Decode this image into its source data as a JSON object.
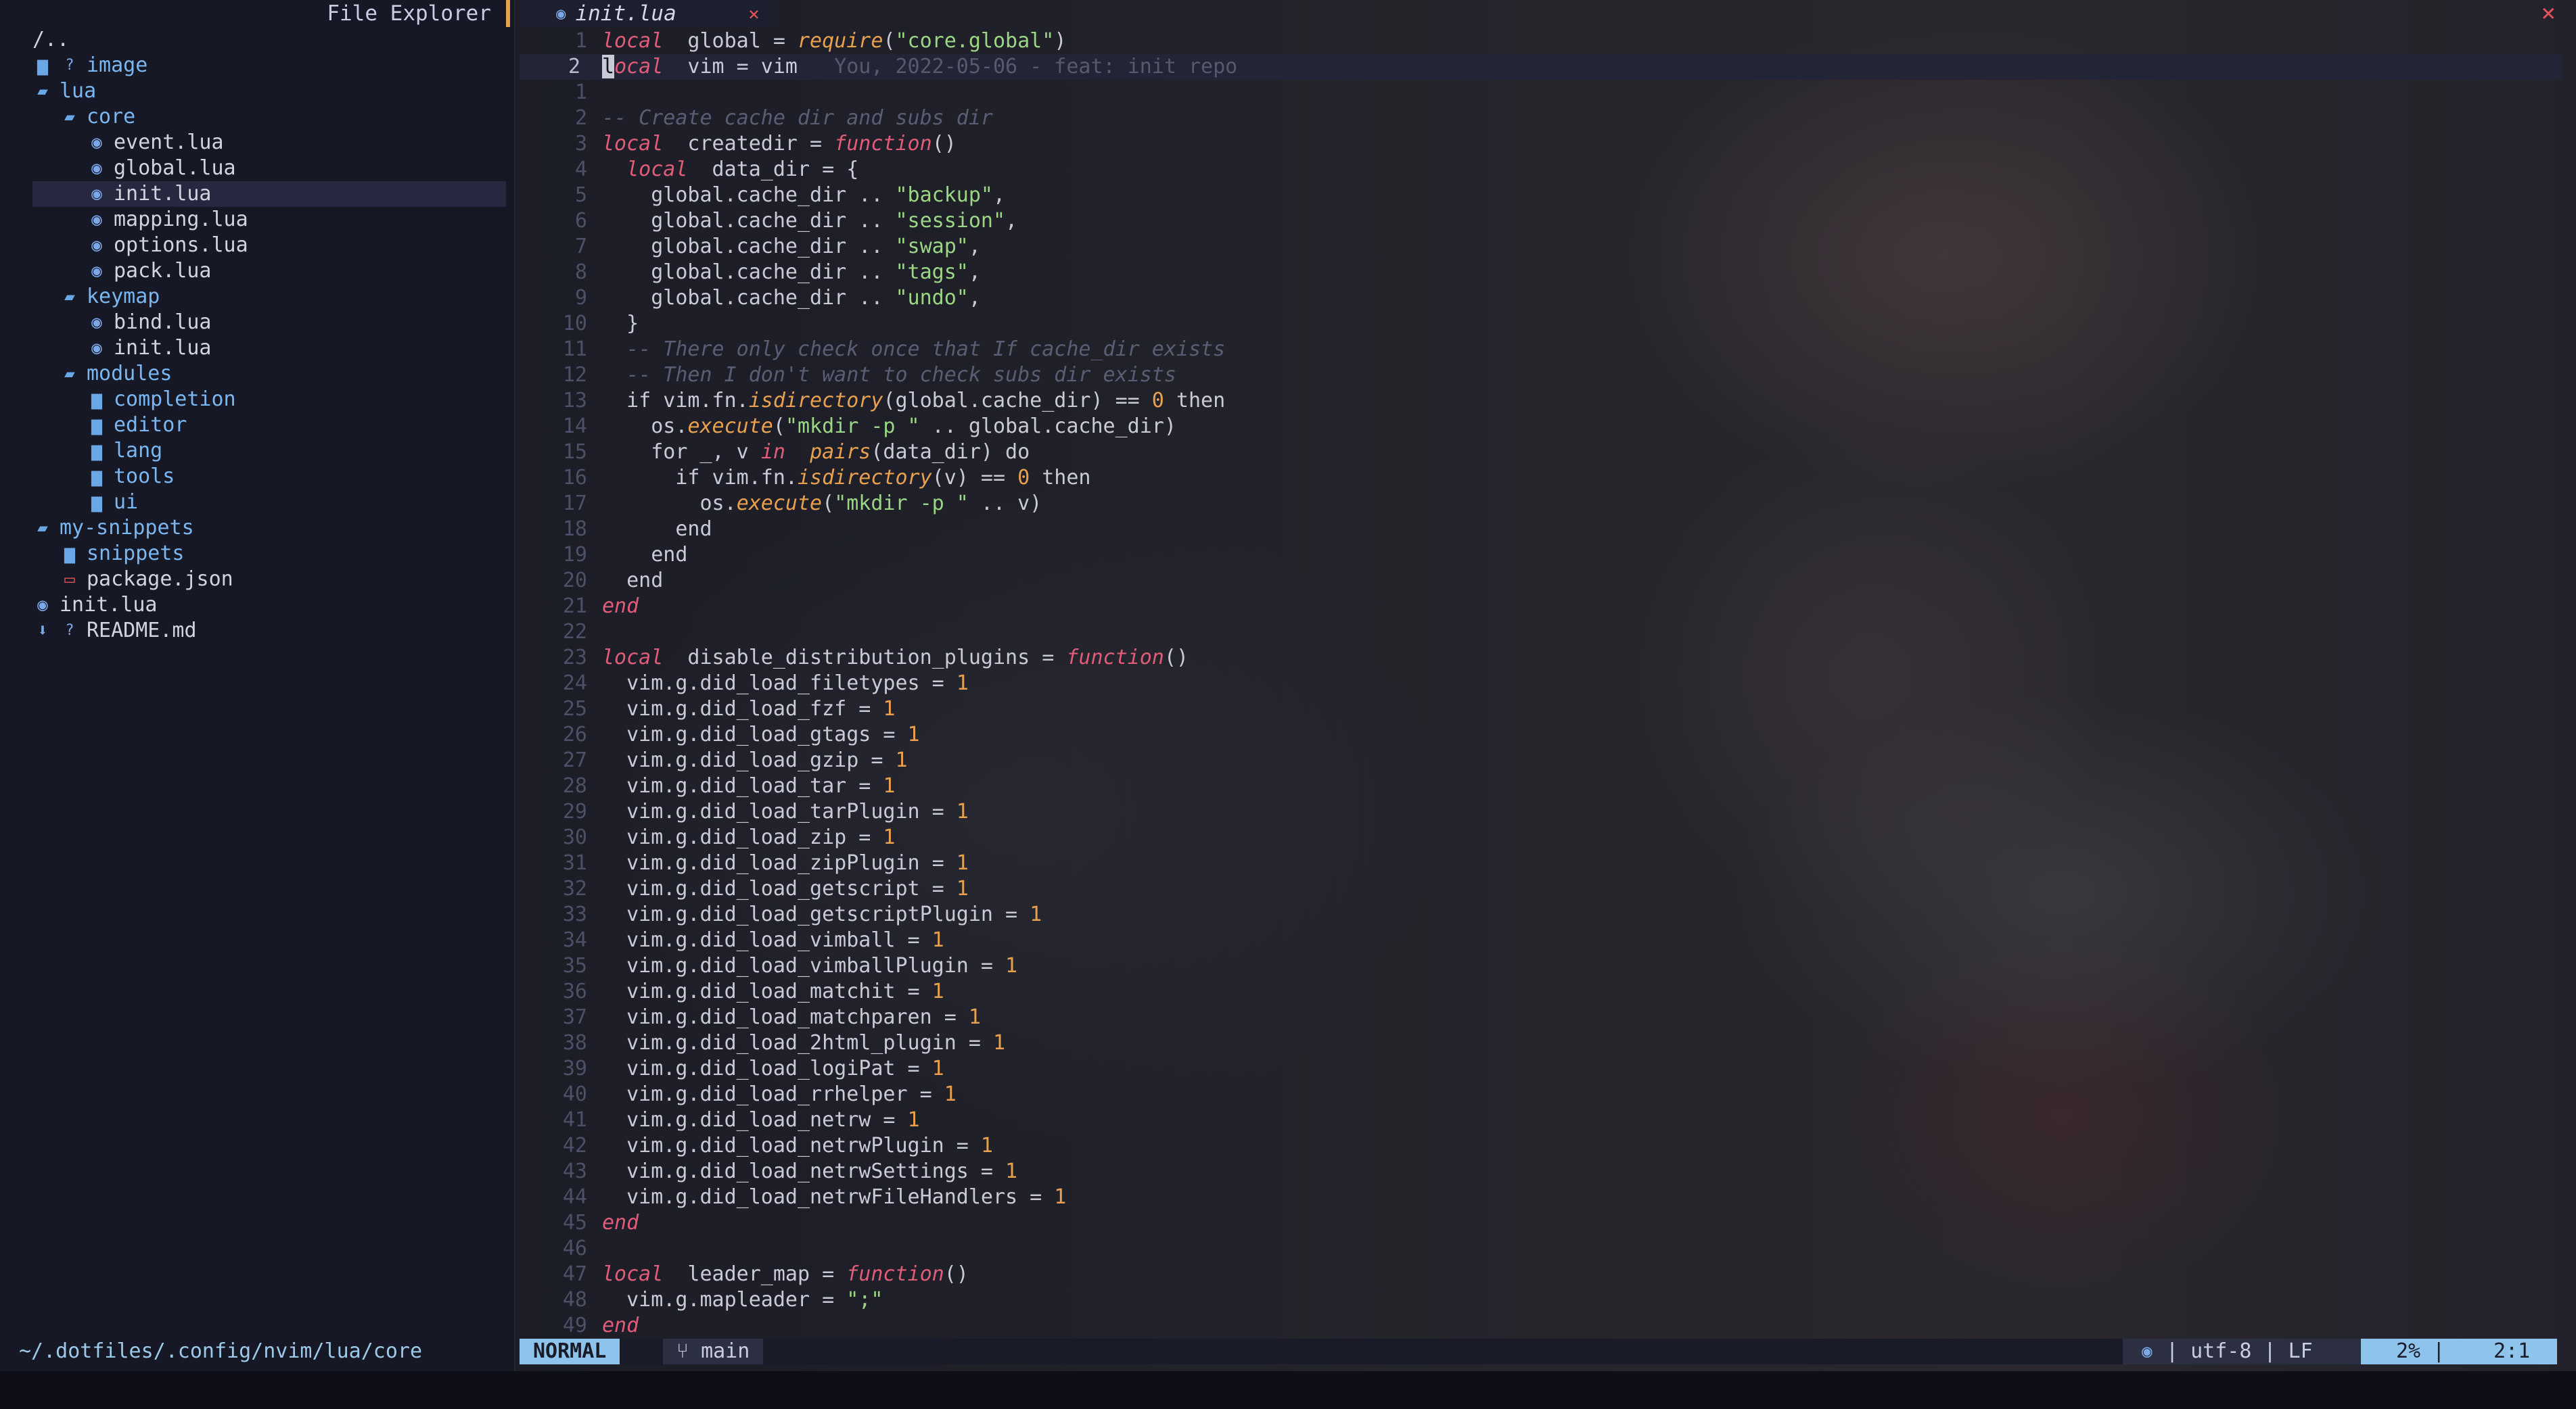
{
  "sidebar": {
    "title": "File Explorer",
    "cwd": "~/.dotfiles/.config/nvim/lua/core",
    "items": [
      {
        "depth": 0,
        "icon": "",
        "label": "/..",
        "kind": "parent"
      },
      {
        "depth": 0,
        "icon": "folder-icon",
        "label": "image",
        "kind": "dir",
        "badge": "?"
      },
      {
        "depth": 0,
        "icon": "folder-open-icon",
        "label": "lua",
        "kind": "dir"
      },
      {
        "depth": 1,
        "icon": "folder-open-icon",
        "label": "core",
        "kind": "dir"
      },
      {
        "depth": 2,
        "icon": "lua-icon",
        "label": "event.lua",
        "kind": "file"
      },
      {
        "depth": 2,
        "icon": "lua-icon",
        "label": "global.lua",
        "kind": "file"
      },
      {
        "depth": 2,
        "icon": "lua-icon",
        "label": "init.lua",
        "kind": "file",
        "selected": true
      },
      {
        "depth": 2,
        "icon": "lua-icon",
        "label": "mapping.lua",
        "kind": "file"
      },
      {
        "depth": 2,
        "icon": "lua-icon",
        "label": "options.lua",
        "kind": "file"
      },
      {
        "depth": 2,
        "icon": "lua-icon",
        "label": "pack.lua",
        "kind": "file"
      },
      {
        "depth": 1,
        "icon": "folder-open-icon",
        "label": "keymap",
        "kind": "dir"
      },
      {
        "depth": 2,
        "icon": "lua-icon",
        "label": "bind.lua",
        "kind": "file"
      },
      {
        "depth": 2,
        "icon": "lua-icon",
        "label": "init.lua",
        "kind": "file"
      },
      {
        "depth": 1,
        "icon": "folder-open-icon",
        "label": "modules",
        "kind": "dir"
      },
      {
        "depth": 2,
        "icon": "folder-icon",
        "label": "completion",
        "kind": "dir"
      },
      {
        "depth": 2,
        "icon": "folder-icon",
        "label": "editor",
        "kind": "dir"
      },
      {
        "depth": 2,
        "icon": "folder-icon",
        "label": "lang",
        "kind": "dir"
      },
      {
        "depth": 2,
        "icon": "folder-icon",
        "label": "tools",
        "kind": "dir"
      },
      {
        "depth": 2,
        "icon": "folder-icon",
        "label": "ui",
        "kind": "dir"
      },
      {
        "depth": 0,
        "icon": "folder-open-icon",
        "label": "my-snippets",
        "kind": "dir"
      },
      {
        "depth": 1,
        "icon": "folder-icon",
        "label": "snippets",
        "kind": "dir"
      },
      {
        "depth": 1,
        "icon": "json-icon",
        "label": "package.json",
        "kind": "json"
      },
      {
        "depth": 0,
        "icon": "lua-icon",
        "label": "init.lua",
        "kind": "file"
      },
      {
        "depth": 0,
        "icon": "markdown-icon",
        "label": "README.md",
        "kind": "md",
        "badge": "?"
      }
    ]
  },
  "tabline": {
    "active_tab": "init.lua",
    "tab_icon": "lua-icon",
    "tab_close": "×",
    "window_close": "×"
  },
  "editor": {
    "current_line": 2,
    "lines": [
      {
        "n": "1",
        "seg": [
          [
            "kw",
            "local"
          ],
          [
            "",
            "  global = "
          ],
          [
            "fn",
            "require"
          ],
          [
            "",
            "("
          ],
          [
            "str",
            "\"core.global\""
          ],
          [
            "",
            ")"
          ]
        ]
      },
      {
        "n": "2",
        "current": true,
        "seg": [
          [
            "cursor",
            "l"
          ],
          [
            "kw",
            "ocal"
          ],
          [
            "",
            "  vim = vim   "
          ],
          [
            "blame",
            "You, 2022-05-06 - feat: init repo"
          ]
        ]
      },
      {
        "n": "1",
        "seg": []
      },
      {
        "n": "2",
        "seg": [
          [
            "cm",
            "-- Create cache dir and subs dir"
          ]
        ]
      },
      {
        "n": "3",
        "seg": [
          [
            "kw",
            "local"
          ],
          [
            "",
            "  createdir = "
          ],
          [
            "kw",
            "function"
          ],
          [
            "",
            "()"
          ]
        ]
      },
      {
        "n": "4",
        "seg": [
          [
            "",
            "  "
          ],
          [
            "kw",
            "local"
          ],
          [
            "",
            "  data_dir = {"
          ]
        ]
      },
      {
        "n": "5",
        "seg": [
          [
            "",
            "    global.cache_dir .. "
          ],
          [
            "str",
            "\"backup\""
          ],
          [
            "",
            ","
          ]
        ]
      },
      {
        "n": "6",
        "seg": [
          [
            "",
            "    global.cache_dir .. "
          ],
          [
            "str",
            "\"session\""
          ],
          [
            "",
            ","
          ]
        ]
      },
      {
        "n": "7",
        "seg": [
          [
            "",
            "    global.cache_dir .. "
          ],
          [
            "str",
            "\"swap\""
          ],
          [
            "",
            ","
          ]
        ]
      },
      {
        "n": "8",
        "seg": [
          [
            "",
            "    global.cache_dir .. "
          ],
          [
            "str",
            "\"tags\""
          ],
          [
            "",
            ","
          ]
        ]
      },
      {
        "n": "9",
        "seg": [
          [
            "",
            "    global.cache_dir .. "
          ],
          [
            "str",
            "\"undo\""
          ],
          [
            "",
            ","
          ]
        ]
      },
      {
        "n": "10",
        "seg": [
          [
            "",
            "  }"
          ]
        ]
      },
      {
        "n": "11",
        "seg": [
          [
            "cm",
            "  -- There only check once that If cache_dir exists"
          ]
        ]
      },
      {
        "n": "12",
        "seg": [
          [
            "cm",
            "  -- Then I don't want to check subs dir exists"
          ]
        ]
      },
      {
        "n": "13",
        "seg": [
          [
            "",
            "  if vim.fn."
          ],
          [
            "fn",
            "isdirectory"
          ],
          [
            "",
            "(global.cache_dir) == "
          ],
          [
            "num",
            "0"
          ],
          [
            "",
            " then"
          ]
        ]
      },
      {
        "n": "14",
        "seg": [
          [
            "",
            "    os."
          ],
          [
            "fn",
            "execute"
          ],
          [
            "",
            "("
          ],
          [
            "str",
            "\"mkdir -p \""
          ],
          [
            "",
            " .. global.cache_dir)"
          ]
        ]
      },
      {
        "n": "15",
        "seg": [
          [
            "",
            "    for _, v "
          ],
          [
            "kw",
            "in"
          ],
          [
            "",
            "  "
          ],
          [
            "fn",
            "pairs"
          ],
          [
            "",
            "(data_dir) do"
          ]
        ]
      },
      {
        "n": "16",
        "seg": [
          [
            "",
            "      if vim.fn."
          ],
          [
            "fn",
            "isdirectory"
          ],
          [
            "",
            "(v) == "
          ],
          [
            "num",
            "0"
          ],
          [
            "",
            " then"
          ]
        ]
      },
      {
        "n": "17",
        "seg": [
          [
            "",
            "        os."
          ],
          [
            "fn",
            "execute"
          ],
          [
            "",
            "("
          ],
          [
            "str",
            "\"mkdir -p \""
          ],
          [
            "",
            " .. v)"
          ]
        ]
      },
      {
        "n": "18",
        "seg": [
          [
            "",
            "      end"
          ]
        ]
      },
      {
        "n": "19",
        "seg": [
          [
            "",
            "    end"
          ]
        ]
      },
      {
        "n": "20",
        "seg": [
          [
            "",
            "  end"
          ]
        ]
      },
      {
        "n": "21",
        "seg": [
          [
            "kw",
            "end"
          ]
        ]
      },
      {
        "n": "22",
        "seg": []
      },
      {
        "n": "23",
        "seg": [
          [
            "kw",
            "local"
          ],
          [
            "",
            "  disable_distribution_plugins = "
          ],
          [
            "kw",
            "function"
          ],
          [
            "",
            "()"
          ]
        ]
      },
      {
        "n": "24",
        "seg": [
          [
            "",
            "  vim.g.did_load_filetypes = "
          ],
          [
            "num",
            "1"
          ]
        ]
      },
      {
        "n": "25",
        "seg": [
          [
            "",
            "  vim.g.did_load_fzf = "
          ],
          [
            "num",
            "1"
          ]
        ]
      },
      {
        "n": "26",
        "seg": [
          [
            "",
            "  vim.g.did_load_gtags = "
          ],
          [
            "num",
            "1"
          ]
        ]
      },
      {
        "n": "27",
        "seg": [
          [
            "",
            "  vim.g.did_load_gzip = "
          ],
          [
            "num",
            "1"
          ]
        ]
      },
      {
        "n": "28",
        "seg": [
          [
            "",
            "  vim.g.did_load_tar = "
          ],
          [
            "num",
            "1"
          ]
        ]
      },
      {
        "n": "29",
        "seg": [
          [
            "",
            "  vim.g.did_load_tarPlugin = "
          ],
          [
            "num",
            "1"
          ]
        ]
      },
      {
        "n": "30",
        "seg": [
          [
            "",
            "  vim.g.did_load_zip = "
          ],
          [
            "num",
            "1"
          ]
        ]
      },
      {
        "n": "31",
        "seg": [
          [
            "",
            "  vim.g.did_load_zipPlugin = "
          ],
          [
            "num",
            "1"
          ]
        ]
      },
      {
        "n": "32",
        "seg": [
          [
            "",
            "  vim.g.did_load_getscript = "
          ],
          [
            "num",
            "1"
          ]
        ]
      },
      {
        "n": "33",
        "seg": [
          [
            "",
            "  vim.g.did_load_getscriptPlugin = "
          ],
          [
            "num",
            "1"
          ]
        ]
      },
      {
        "n": "34",
        "seg": [
          [
            "",
            "  vim.g.did_load_vimball = "
          ],
          [
            "num",
            "1"
          ]
        ]
      },
      {
        "n": "35",
        "seg": [
          [
            "",
            "  vim.g.did_load_vimballPlugin = "
          ],
          [
            "num",
            "1"
          ]
        ]
      },
      {
        "n": "36",
        "seg": [
          [
            "",
            "  vim.g.did_load_matchit = "
          ],
          [
            "num",
            "1"
          ]
        ]
      },
      {
        "n": "37",
        "seg": [
          [
            "",
            "  vim.g.did_load_matchparen = "
          ],
          [
            "num",
            "1"
          ]
        ]
      },
      {
        "n": "38",
        "seg": [
          [
            "",
            "  vim.g.did_load_2html_plugin = "
          ],
          [
            "num",
            "1"
          ]
        ]
      },
      {
        "n": "39",
        "seg": [
          [
            "",
            "  vim.g.did_load_logiPat = "
          ],
          [
            "num",
            "1"
          ]
        ]
      },
      {
        "n": "40",
        "seg": [
          [
            "",
            "  vim.g.did_load_rrhelper = "
          ],
          [
            "num",
            "1"
          ]
        ]
      },
      {
        "n": "41",
        "seg": [
          [
            "",
            "  vim.g.did_load_netrw = "
          ],
          [
            "num",
            "1"
          ]
        ]
      },
      {
        "n": "42",
        "seg": [
          [
            "",
            "  vim.g.did_load_netrwPlugin = "
          ],
          [
            "num",
            "1"
          ]
        ]
      },
      {
        "n": "43",
        "seg": [
          [
            "",
            "  vim.g.did_load_netrwSettings = "
          ],
          [
            "num",
            "1"
          ]
        ]
      },
      {
        "n": "44",
        "seg": [
          [
            "",
            "  vim.g.did_load_netrwFileHandlers = "
          ],
          [
            "num",
            "1"
          ]
        ]
      },
      {
        "n": "45",
        "seg": [
          [
            "kw",
            "end"
          ]
        ]
      },
      {
        "n": "46",
        "seg": []
      },
      {
        "n": "47",
        "seg": [
          [
            "kw",
            "local"
          ],
          [
            "",
            "  leader_map = "
          ],
          [
            "kw",
            "function"
          ],
          [
            "",
            "()"
          ]
        ]
      },
      {
        "n": "48",
        "seg": [
          [
            "",
            "  vim.g.mapleader = "
          ],
          [
            "str",
            "\";\""
          ]
        ]
      },
      {
        "n": "49",
        "seg": [
          [
            "kw",
            "end"
          ]
        ]
      }
    ]
  },
  "statusline": {
    "mode": "NORMAL",
    "branch_icon": "git-branch-icon",
    "branch": "main",
    "filetype_icon": "lua-icon",
    "encoding": "| utf-8 | LF",
    "percent": "2% |",
    "position": "2:1"
  }
}
